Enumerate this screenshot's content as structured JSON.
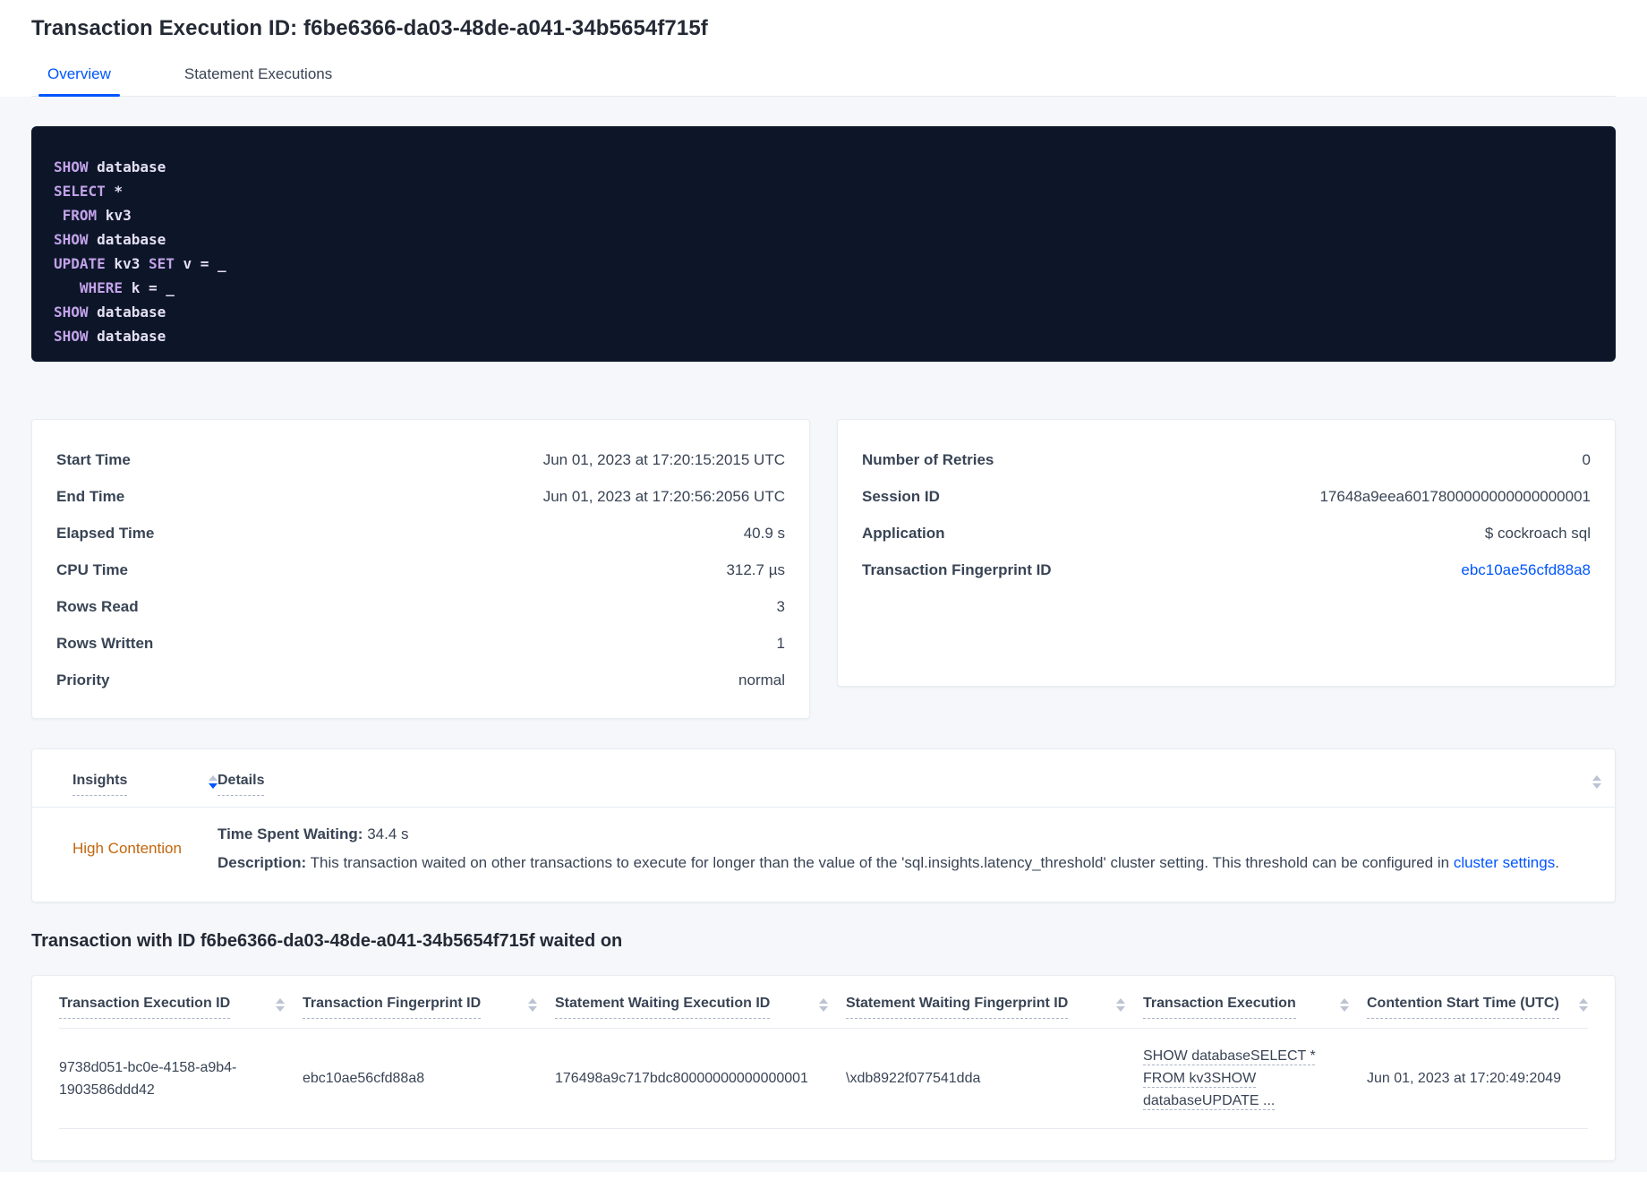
{
  "colors": {
    "accent-blue": "#0055ff",
    "accent-orange": "#c2660c",
    "sql-bg": "#0c1628",
    "sql-keyword": "#c3a2e9",
    "sql-text": "#e5dff3"
  },
  "header": {
    "title": "Transaction Execution ID: f6be6366-da03-48de-a041-34b5654f715f"
  },
  "tabs": [
    {
      "label": "Overview",
      "active": true
    },
    {
      "label": "Statement Executions",
      "active": false
    }
  ],
  "sql": {
    "lines": [
      [
        {
          "text": "SHOW",
          "kw": true
        },
        {
          "text": " database",
          "kw": false
        }
      ],
      [
        {
          "text": "SELECT",
          "kw": true
        },
        {
          "text": " *",
          "kw": false
        }
      ],
      [
        {
          "text": " FROM",
          "kw": true
        },
        {
          "text": " kv3",
          "kw": false
        }
      ],
      [
        {
          "text": "SHOW",
          "kw": true
        },
        {
          "text": " database",
          "kw": false
        }
      ],
      [
        {
          "text": "UPDATE",
          "kw": true
        },
        {
          "text": " kv3 ",
          "kw": false
        },
        {
          "text": "SET",
          "kw": true
        },
        {
          "text": " v = _",
          "kw": false
        }
      ],
      [
        {
          "text": "   WHERE",
          "kw": true
        },
        {
          "text": " k = _",
          "kw": false
        }
      ],
      [
        {
          "text": "SHOW",
          "kw": true
        },
        {
          "text": " database",
          "kw": false
        }
      ],
      [
        {
          "text": "SHOW",
          "kw": true
        },
        {
          "text": " database",
          "kw": false
        }
      ]
    ]
  },
  "execution_card": {
    "rows": [
      {
        "label": "Start Time",
        "value": "Jun 01, 2023 at 17:20:15:2015 UTC"
      },
      {
        "label": "End Time",
        "value": "Jun 01, 2023 at 17:20:56:2056 UTC"
      },
      {
        "label": "Elapsed Time",
        "value": "40.9 s"
      },
      {
        "label": "CPU Time",
        "value": "312.7 µs"
      },
      {
        "label": "Rows Read",
        "value": "3"
      },
      {
        "label": "Rows Written",
        "value": "1"
      },
      {
        "label": "Priority",
        "value": "normal"
      }
    ]
  },
  "session_card": {
    "rows": [
      {
        "label": "Number of Retries",
        "value": "0"
      },
      {
        "label": "Session ID",
        "value": "17648a9eea6017800000000000000001"
      },
      {
        "label": "Application",
        "value": "$ cockroach sql"
      },
      {
        "label": "Transaction Fingerprint ID",
        "value": "ebc10ae56cfd88a8",
        "link": true
      }
    ]
  },
  "insights": {
    "columns": [
      {
        "label": "Insights",
        "sorted": "desc"
      },
      {
        "label": "Details"
      }
    ],
    "rows": [
      {
        "insight": "High Contention",
        "waiting_label": "Time Spent Waiting:",
        "waiting_value": "34.4 s",
        "description_label": "Description:",
        "description_text": "This transaction waited on other transactions to execute for longer than the value of the 'sql.insights.latency_threshold' cluster setting. This threshold can be configured in ",
        "description_link": "cluster settings",
        "description_suffix": "."
      }
    ]
  },
  "waited_on": {
    "title": "Transaction with ID f6be6366-da03-48de-a041-34b5654f715f waited on",
    "columns": [
      "Transaction Execution ID",
      "Transaction Fingerprint ID",
      "Statement Waiting Execution ID",
      "Statement Waiting Fingerprint ID",
      "Transaction Execution",
      "Contention Start Time (UTC)"
    ],
    "rows": [
      {
        "transaction_execution_id": "9738d051-bc0e-4158-a9b4-1903586ddd42",
        "transaction_fingerprint_id": "ebc10ae56cfd88a8",
        "statement_waiting_execution_id": "176498a9c717bdc80000000000000001",
        "statement_waiting_fingerprint_id": "\\xdb8922f077541dda",
        "transaction_execution": "SHOW databaseSELECT * FROM kv3SHOW databaseUPDATE ...",
        "contention_start_time": "Jun 01, 2023 at 17:20:49:2049"
      }
    ]
  }
}
